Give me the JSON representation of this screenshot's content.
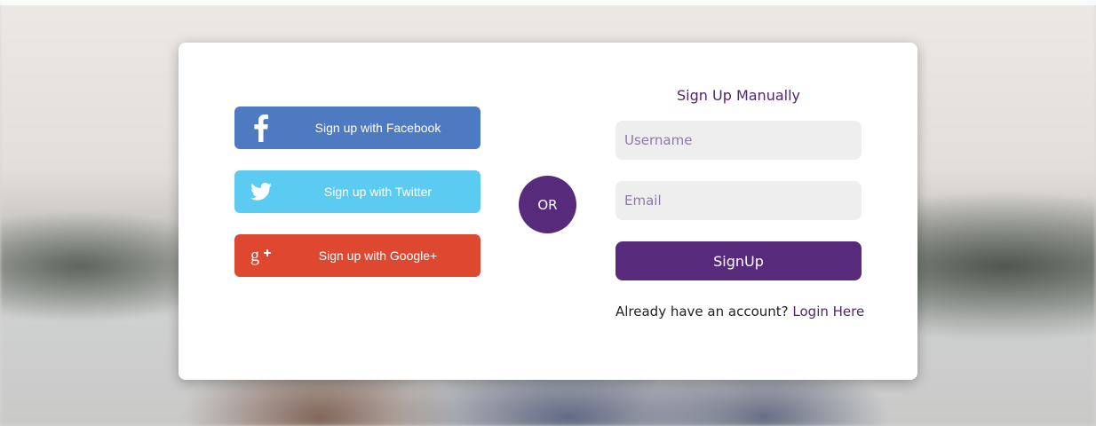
{
  "colors": {
    "facebook": "#4e7ac1",
    "twitter": "#5ccbf1",
    "google": "#de4730",
    "accent": "#572a7b"
  },
  "social": {
    "facebook": {
      "label": "Sign up with Facebook",
      "icon": "facebook-icon"
    },
    "twitter": {
      "label": "Sign up with Twitter",
      "icon": "twitter-icon"
    },
    "google": {
      "label": "Sign up with Google+",
      "icon": "google-plus-icon"
    }
  },
  "divider": {
    "label": "OR"
  },
  "manual": {
    "title": "Sign Up Manually",
    "username": {
      "value": "",
      "placeholder": "Username"
    },
    "email": {
      "value": "",
      "placeholder": "Email"
    },
    "submit_label": "SignUp",
    "login_prompt": "Already have an account?",
    "login_link": "Login Here"
  }
}
